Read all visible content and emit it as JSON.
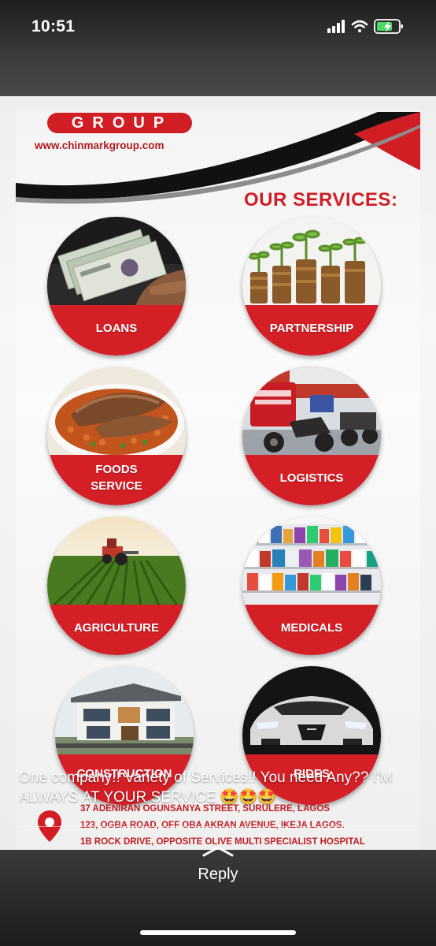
{
  "status_bar": {
    "time": "10:51"
  },
  "flyer": {
    "brand_word": "GROUP",
    "website": "www.chinmarkgroup.com",
    "services_title": "OUR SERVICES:",
    "services": [
      {
        "label": "LOANS",
        "image": "cash-in-hand"
      },
      {
        "label": "PARTNERSHIP",
        "image": "coins-with-seedlings"
      },
      {
        "label": "FOODS SERVICE",
        "image": "jollof-rice-plate"
      },
      {
        "label": "LOGISTICS",
        "image": "delivery-motorbikes"
      },
      {
        "label": "AGRICULTURE",
        "image": "tractor-field"
      },
      {
        "label": "MEDICALS",
        "image": "pharmacy-shelves"
      },
      {
        "label": "CONSTRUCTION",
        "image": "modern-house"
      },
      {
        "label": "RIDES",
        "image": "luxury-car"
      }
    ],
    "addresses": [
      "37 ADENIRAN OGUNSANYA STREET, SURULERE, LAGOS",
      "123, OGBA ROAD, OFF OBA AKRAN AVENUE, IKEJA LAGOS.",
      "1B ROCK DRIVE, OPPOSITE OLIVE MULTI SPECIALIST HOSPITAL"
    ]
  },
  "story": {
    "caption": "One company!! Variety of Services!! You need Any?? I'M  ALWAYS AT YOUR SERVICE 🤩🤩🤩",
    "reply_label": "Reply"
  },
  "colors": {
    "brand_red": "#d01e24",
    "band_red": "#d41f26"
  }
}
